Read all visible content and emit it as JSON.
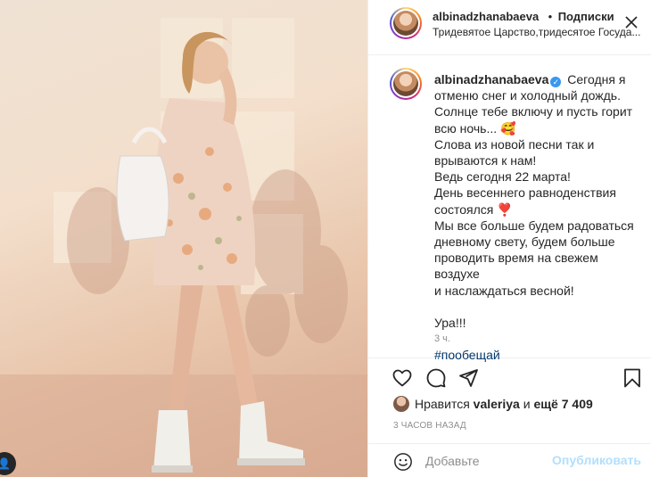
{
  "post": {
    "author": "albinadzhanabaeva",
    "follow_separator": "•",
    "follow_label": "Подписки",
    "location": "Тридевятое Царство,тридесятое Госуда...",
    "more_icon": "more-dots-icon"
  },
  "caption": {
    "author": "albinadzhanabaeva",
    "verified_mark": "✓",
    "lines": [
      "Сегодня я",
      "отменю снег и холодный дождь.",
      "Солнце тебе включу и пусть горит",
      "всю ночь... 🥰",
      "Слова из новой песни так и",
      "врываются к нам!",
      "Ведь сегодня 22 марта!",
      "День весеннего равноденствия",
      "состоялся ❣️",
      "Мы все больше будем радоваться",
      "дневному свету, будем больше",
      "проводить время на свежем воздухе",
      "и наслаждаться весной!",
      "",
      "Ура!!!",
      "",
      "#пообещай"
    ],
    "time_ago": "3 ч."
  },
  "actions": {
    "like_icon": "heart-icon",
    "comment_icon": "comment-bubble-icon",
    "share_icon": "paper-plane-icon",
    "save_icon": "bookmark-icon"
  },
  "likes": {
    "prefix": "Нравится",
    "user": "valeriya",
    "middle": "и",
    "count_text": "ещё 7 409"
  },
  "timestamp": "3 ЧАСОВ НАЗАД",
  "comment": {
    "emoji_icon": "smiley-icon",
    "placeholder": "Добавьте",
    "post_label": "Опубликовать"
  },
  "colors": {
    "link_blue": "#00376b",
    "verified_blue": "#3897f0",
    "post_button_disabled": "#b2dffc",
    "meta_grey": "#8e8e8e"
  }
}
